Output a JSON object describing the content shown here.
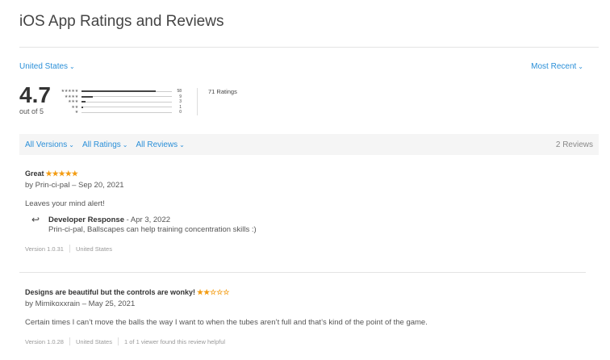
{
  "header": {
    "title": "iOS App Ratings and Reviews"
  },
  "country_select": {
    "label": "United States",
    "icon": "chevron-down-icon"
  },
  "sort_select": {
    "label": "Most Recent",
    "icon": "chevron-down-icon"
  },
  "summary": {
    "average": "4.7",
    "out_of": "out of 5",
    "ratings_count": "71 Ratings",
    "histogram": [
      {
        "stars": "★★★★★",
        "count": "58",
        "fraction": 0.817
      },
      {
        "stars": "★★★★",
        "count": "9",
        "fraction": 0.127
      },
      {
        "stars": "★★★",
        "count": "3",
        "fraction": 0.042
      },
      {
        "stars": "★★",
        "count": "1",
        "fraction": 0.014
      },
      {
        "stars": "★",
        "count": "0",
        "fraction": 0.0
      }
    ]
  },
  "filters": {
    "versions": "All Versions",
    "ratings": "All Ratings",
    "reviews": "All Reviews",
    "review_count": "2 Reviews"
  },
  "reviews": [
    {
      "title": "Great",
      "stars": "★★★★★",
      "rating": 5,
      "byline": "by Prin-ci-pal – Sep 20, 2021",
      "body": "Leaves your mind alert!",
      "developer_response": {
        "label": "Developer Response",
        "date": " - Apr 3, 2022",
        "text": "Prin-ci-pal, Ballscapes can help training concentration skills :)"
      },
      "version": "Version 1.0.31",
      "country": "United States"
    },
    {
      "title": "Designs are beautiful but the controls are wonky!",
      "stars": "★★☆☆☆",
      "rating": 2,
      "byline": "by Mimikoxxrain – May 25, 2021",
      "body": "Certain times I can’t move the balls the way I want to when the tubes aren’t full and that’s kind of the point of the game.",
      "version": "Version 1.0.28",
      "country": "United States",
      "helpful": "1 of 1 viewer found this review helpful"
    }
  ],
  "colors": {
    "link": "#2a8fd8",
    "star": "#f39c12",
    "filter_bg": "#f5f5f5"
  }
}
